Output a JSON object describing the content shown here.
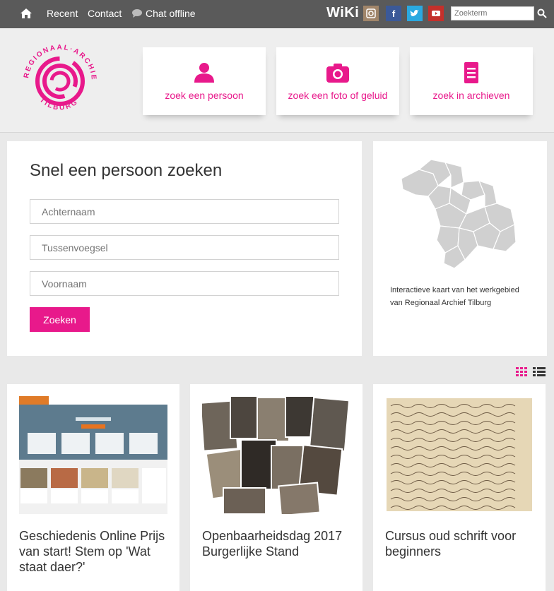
{
  "topbar": {
    "nav": [
      {
        "label": "Recent"
      },
      {
        "label": "Contact"
      },
      {
        "label": "Chat offline"
      }
    ],
    "wiki": "WiKi",
    "search_placeholder": "Zoekterm"
  },
  "logo": {
    "text_top": "REGIONAAL ARCHIEF",
    "text_bottom": "TILBURG",
    "color": "#e8198b"
  },
  "tiles": [
    {
      "label": "zoek een persoon",
      "icon": "person-icon"
    },
    {
      "label": "zoek een foto of geluid",
      "icon": "camera-icon"
    },
    {
      "label": "zoek in archieven",
      "icon": "document-icon"
    }
  ],
  "search": {
    "title": "Snel een persoon zoeken",
    "fields": [
      {
        "placeholder": "Achternaam"
      },
      {
        "placeholder": "Tussenvoegsel"
      },
      {
        "placeholder": "Voornaam"
      }
    ],
    "button": "Zoeken"
  },
  "map": {
    "caption": "Interactieve kaart van het werkgebied van Regionaal Archief Tilburg"
  },
  "cards": [
    {
      "title": "Geschiedenis Online Prijs van start! Stem op 'Wat staat daer?'"
    },
    {
      "title": "Openbaarheidsdag 2017 Burgerlijke Stand"
    },
    {
      "title": "Cursus oud schrift voor beginners"
    }
  ],
  "colors": {
    "accent": "#e8198b",
    "topbar": "#5a5a5a"
  }
}
